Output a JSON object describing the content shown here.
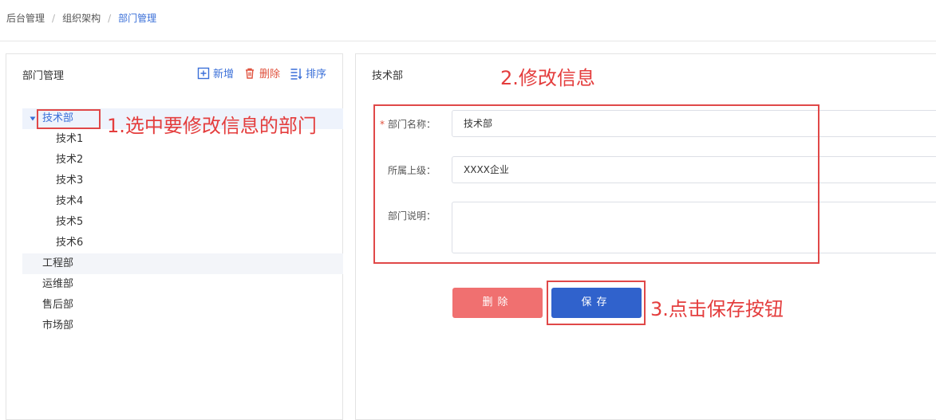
{
  "breadcrumb": {
    "items": [
      "后台管理",
      "组织架构",
      "部门管理"
    ],
    "separator": "/"
  },
  "left_panel": {
    "title": "部门管理",
    "toolbar": {
      "add_label": "新增",
      "delete_label": "删除",
      "sort_label": "排序"
    },
    "tree": {
      "root_selected": "技术部",
      "children": [
        "技术1",
        "技术2",
        "技术3",
        "技术4",
        "技术5",
        "技术6"
      ],
      "other_roots": [
        "工程部",
        "运维部",
        "售后部",
        "市场部"
      ]
    }
  },
  "right_panel": {
    "title": "技术部",
    "form": {
      "name_label": "部门名称：",
      "name_value": "技术部",
      "parent_label": "所属上级：",
      "parent_value": "XXXX企业",
      "desc_label": "部门说明：",
      "desc_value": ""
    },
    "buttons": {
      "delete_label": "删除",
      "save_label": "保存"
    }
  },
  "annotations": {
    "step1": "1.选中要修改信息的部门",
    "step2": "2.修改信息",
    "step3": "3.点击保存按钮"
  },
  "colors": {
    "primary": "#3062cc",
    "danger": "#f07070",
    "annotation": "#e43d3d",
    "link": "#3a6fd8"
  },
  "icons": [
    "plus-square-icon",
    "trash-icon",
    "sort-icon",
    "caret-down-icon"
  ]
}
